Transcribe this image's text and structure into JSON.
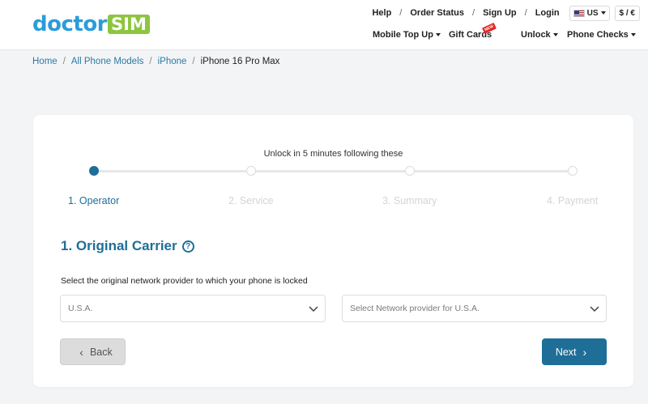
{
  "header": {
    "logo": {
      "part1": "doctor",
      "part2": "SIM"
    },
    "top_links": [
      "Help",
      "Order Status",
      "Sign Up",
      "Login"
    ],
    "language": "US",
    "currency": "$ / €",
    "nav": {
      "mobile_top_up": "Mobile Top Up",
      "gift_cards": "Gift Cards",
      "new_badge": "NEW",
      "unlock": "Unlock",
      "phone_checks": "Phone Checks"
    }
  },
  "breadcrumb": {
    "items": [
      "Home",
      "All Phone Models",
      "iPhone"
    ],
    "current": "iPhone 16 Pro Max"
  },
  "wizard": {
    "intro": "Unlock in 5 minutes following these",
    "steps": [
      "1. Operator",
      "2. Service",
      "3. Summary",
      "4. Payment"
    ],
    "active_step": 1
  },
  "section": {
    "title": "1. Original Carrier",
    "help_icon": "question-circle-icon",
    "instruction": "Select the original network provider to which your phone is locked"
  },
  "selects": {
    "country": {
      "value": "U.S.A."
    },
    "provider": {
      "placeholder": "Select Network provider for U.S.A."
    }
  },
  "buttons": {
    "back": "Back",
    "next": "Next"
  },
  "colors": {
    "primary": "#1e6e98",
    "logo_blue": "#2a9dd8",
    "logo_green": "#8cc63f",
    "badge_red": "#e12727"
  }
}
